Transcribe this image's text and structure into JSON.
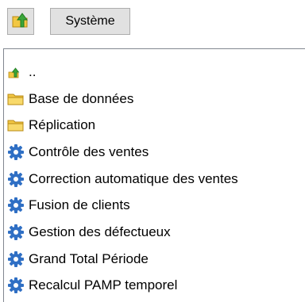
{
  "toolbar": {
    "up_icon": "folder-up-icon",
    "path_label": "Système"
  },
  "list": {
    "items": [
      {
        "label": "..",
        "icon": "parent-folder-icon"
      },
      {
        "label": "Base de données",
        "icon": "folder-icon"
      },
      {
        "label": "Réplication",
        "icon": "folder-icon"
      },
      {
        "label": "Contrôle des ventes",
        "icon": "gear-icon"
      },
      {
        "label": "Correction automatique des ventes",
        "icon": "gear-icon"
      },
      {
        "label": "Fusion de clients",
        "icon": "gear-icon"
      },
      {
        "label": "Gestion des défectueux",
        "icon": "gear-icon"
      },
      {
        "label": "Grand Total Période",
        "icon": "gear-icon"
      },
      {
        "label": "Recalcul PAMP temporel",
        "icon": "gear-icon"
      }
    ]
  },
  "colors": {
    "folder": "#f2c744",
    "gear": "#2f6fc4",
    "arrow": "#3aa53a"
  }
}
